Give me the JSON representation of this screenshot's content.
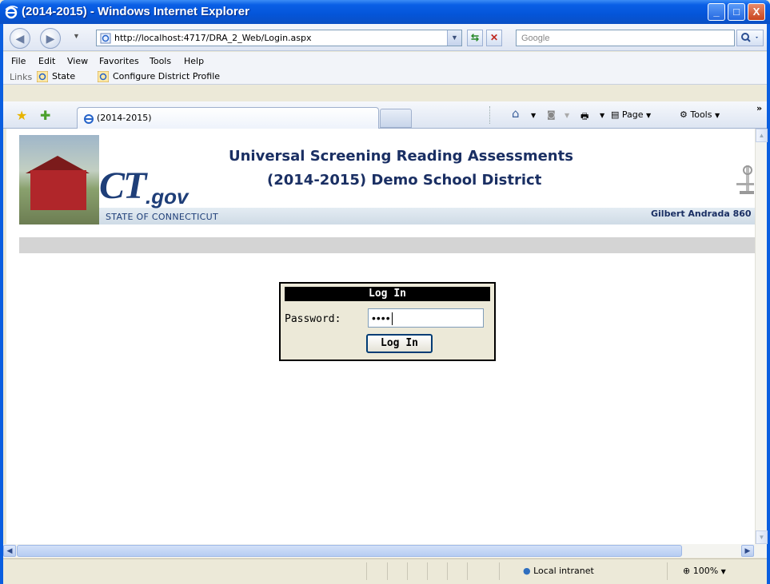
{
  "window": {
    "title": "(2014-2015) - Windows Internet Explorer",
    "controls": {
      "minimize": "_",
      "maximize": "□",
      "close": "X"
    }
  },
  "address_bar": {
    "url": "http://localhost:4717/DRA_2_Web/Login.aspx",
    "search_placeholder": "Google"
  },
  "menu": [
    "File",
    "Edit",
    "View",
    "Favorites",
    "Tools",
    "Help"
  ],
  "links_bar": {
    "label": "Links",
    "items": [
      "State",
      "Configure District Profile"
    ]
  },
  "tabs": [
    {
      "label": "(2014-2015)"
    }
  ],
  "command_bar": {
    "page": "Page",
    "tools": "Tools"
  },
  "banner": {
    "logo_ct": "CT",
    "logo_gov": ".gov",
    "state": "STATE OF CONNECTICUT",
    "heading_line1": "Universal Screening Reading Assessments",
    "heading_line2": "(2014-2015) Demo School District",
    "user": "Gilbert Andrada 860"
  },
  "login": {
    "header": "Log In",
    "password_label": "Password:",
    "password_value": "••••",
    "button_label": "Log In"
  },
  "status_bar": {
    "zone": "Local intranet",
    "zoom": "100%"
  }
}
